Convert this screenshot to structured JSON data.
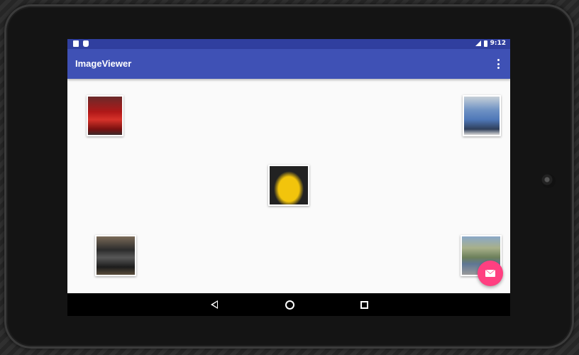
{
  "status_bar": {
    "time": "9:12",
    "left_icons": [
      "sd-card-icon",
      "android-icon"
    ],
    "right_icons": [
      "signal-icon",
      "battery-icon"
    ]
  },
  "app_bar": {
    "title": "ImageViewer",
    "menu_icon": "overflow-menu-icon"
  },
  "gallery": {
    "images": [
      {
        "name": "red-car-image"
      },
      {
        "name": "blue-car-image"
      },
      {
        "name": "yellow-car-image"
      },
      {
        "name": "black-car-image"
      },
      {
        "name": "street-car-image"
      }
    ]
  },
  "fab": {
    "icon": "email-icon",
    "color": "#ff4081"
  },
  "nav_bar": {
    "icons": [
      "back-icon",
      "home-icon",
      "recents-icon"
    ]
  },
  "colors": {
    "primary": "#3f51b5",
    "primary_dark": "#303f9f",
    "accent": "#ff4081"
  }
}
